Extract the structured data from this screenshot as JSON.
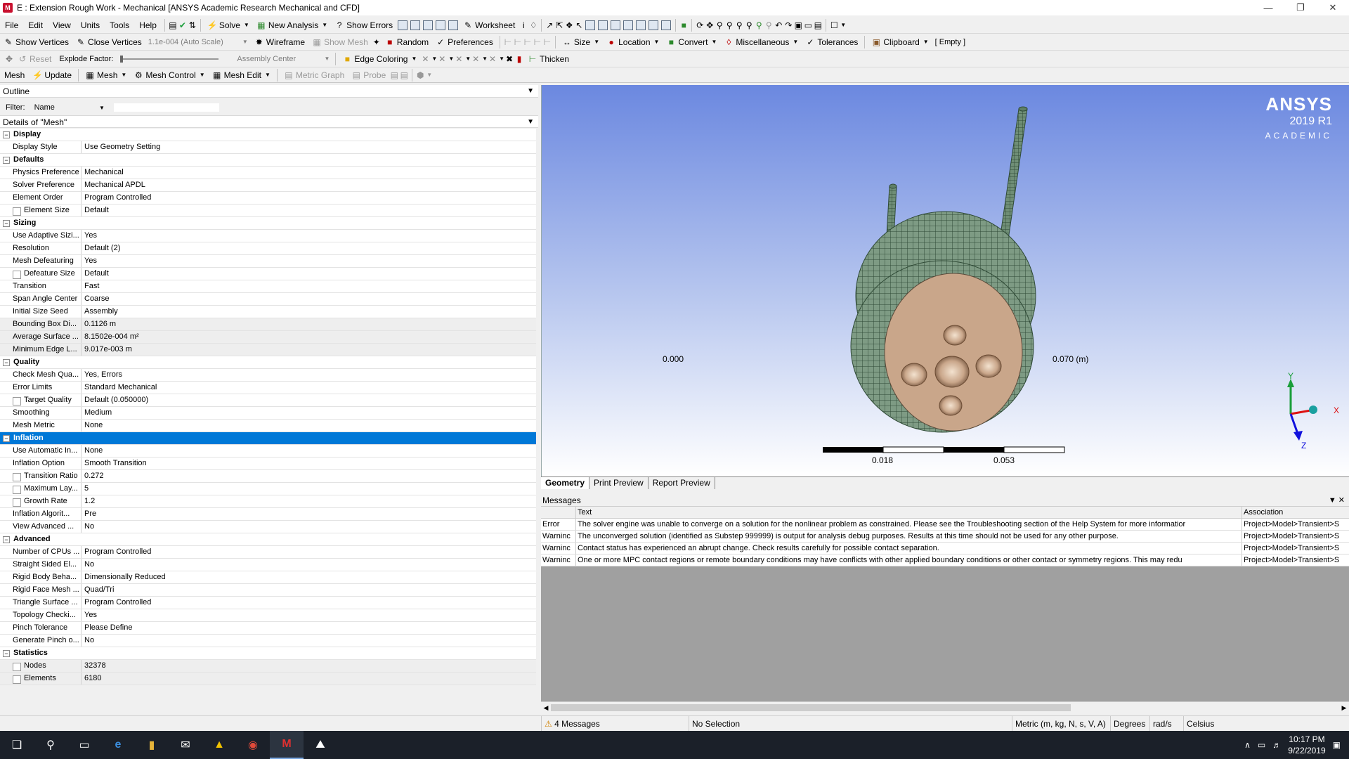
{
  "window": {
    "title": "E : Extension Rough Work - Mechanical [ANSYS Academic Research Mechanical and CFD]",
    "app_icon_letter": "M"
  },
  "menu": [
    "File",
    "Edit",
    "View",
    "Units",
    "Tools",
    "Help"
  ],
  "toolbar1": {
    "solve": "Solve",
    "new_analysis": "New Analysis",
    "show_errors": "Show Errors",
    "worksheet": "Worksheet"
  },
  "toolbar2": {
    "show_vertices": "Show Vertices",
    "close_vertices": "Close Vertices",
    "scale_combo": "1.1e-004 (Auto Scale)",
    "wireframe": "Wireframe",
    "show_mesh": "Show Mesh",
    "random": "Random",
    "preferences": "Preferences",
    "size": "Size",
    "location": "Location",
    "convert": "Convert",
    "miscellaneous": "Miscellaneous",
    "tolerances": "Tolerances",
    "clipboard": "Clipboard",
    "clipboard_value": "[ Empty ]"
  },
  "toolbar3": {
    "reset": "Reset",
    "explode_factor": "Explode Factor:",
    "assembly_center": "Assembly Center",
    "edge_coloring": "Edge Coloring",
    "thicken": "Thicken"
  },
  "toolbar4": {
    "mesh": "Mesh",
    "update": "Update",
    "mesh_dd": "Mesh",
    "mesh_control": "Mesh Control",
    "mesh_edit": "Mesh Edit",
    "metric_graph": "Metric Graph",
    "probe": "Probe"
  },
  "outline": {
    "title": "Outline",
    "filter_label": "Filter:",
    "filter_value": "Name"
  },
  "details": {
    "title": "Details of \"Mesh\"",
    "groups": [
      {
        "name": "Display",
        "rows": [
          {
            "k": "Display Style",
            "v": "Use Geometry Setting"
          }
        ]
      },
      {
        "name": "Defaults",
        "rows": [
          {
            "k": "Physics Preference",
            "v": "Mechanical"
          },
          {
            "k": "Solver Preference",
            "v": "Mechanical APDL"
          },
          {
            "k": "Element Order",
            "v": "Program Controlled"
          },
          {
            "k": "Element Size",
            "v": "Default",
            "cb": true
          }
        ]
      },
      {
        "name": "Sizing",
        "rows": [
          {
            "k": "Use Adaptive Sizi...",
            "v": "Yes"
          },
          {
            "k": "Resolution",
            "v": "Default (2)"
          },
          {
            "k": "Mesh Defeaturing",
            "v": "Yes"
          },
          {
            "k": "Defeature Size",
            "v": "Default",
            "cb": true
          },
          {
            "k": "Transition",
            "v": "Fast"
          },
          {
            "k": "Span Angle Center",
            "v": "Coarse"
          },
          {
            "k": "Initial Size Seed",
            "v": "Assembly"
          },
          {
            "k": "Bounding Box Di...",
            "v": "0.1126 m",
            "ro": true
          },
          {
            "k": "Average Surface ...",
            "v": "8.1502e-004 m²",
            "ro": true
          },
          {
            "k": "Minimum Edge L...",
            "v": "9.017e-003 m",
            "ro": true
          }
        ]
      },
      {
        "name": "Quality",
        "rows": [
          {
            "k": "Check Mesh Qua...",
            "v": "Yes, Errors"
          },
          {
            "k": "Error Limits",
            "v": "Standard Mechanical"
          },
          {
            "k": "Target Quality",
            "v": "Default (0.050000)",
            "cb": true
          },
          {
            "k": "Smoothing",
            "v": "Medium"
          },
          {
            "k": "Mesh Metric",
            "v": "None"
          }
        ]
      },
      {
        "name": "Inflation",
        "selected": true,
        "rows": [
          {
            "k": "Use Automatic In...",
            "v": "None"
          },
          {
            "k": "Inflation Option",
            "v": "Smooth Transition"
          },
          {
            "k": "Transition Ratio",
            "v": "0.272",
            "cb": true
          },
          {
            "k": "Maximum Lay...",
            "v": "5",
            "cb": true
          },
          {
            "k": "Growth Rate",
            "v": "1.2",
            "cb": true
          },
          {
            "k": "Inflation Algorit...",
            "v": "Pre"
          },
          {
            "k": "View Advanced ...",
            "v": "No"
          }
        ]
      },
      {
        "name": "Advanced",
        "rows": [
          {
            "k": "Number of CPUs ...",
            "v": "Program Controlled"
          },
          {
            "k": "Straight Sided El...",
            "v": "No"
          },
          {
            "k": "Rigid Body Beha...",
            "v": "Dimensionally Reduced"
          },
          {
            "k": "Rigid Face Mesh ...",
            "v": "Quad/Tri"
          },
          {
            "k": "Triangle Surface ...",
            "v": "Program Controlled"
          },
          {
            "k": "Topology Checki...",
            "v": "Yes"
          },
          {
            "k": "Pinch Tolerance",
            "v": "Please Define"
          },
          {
            "k": "Generate Pinch o...",
            "v": "No"
          }
        ]
      },
      {
        "name": "Statistics",
        "rows": [
          {
            "k": "Nodes",
            "v": "32378",
            "cb": true,
            "ro": true
          },
          {
            "k": "Elements",
            "v": "6180",
            "cb": true,
            "ro": true
          }
        ]
      }
    ]
  },
  "viewport": {
    "logo_line1": "ANSYS",
    "logo_line2": "2019 R1",
    "logo_line3": "ACADEMIC",
    "scale_labels": {
      "start": "0.000",
      "end": "0.070 (m)",
      "mid1": "0.018",
      "mid2": "0.053"
    },
    "triad": {
      "x": "X",
      "y": "Y",
      "z": "Z"
    }
  },
  "view_tabs": [
    "Geometry",
    "Print Preview",
    "Report Preview"
  ],
  "messages": {
    "title": "Messages",
    "columns": [
      "",
      "Text",
      "Association"
    ],
    "rows": [
      {
        "type": "Error",
        "text": "The solver engine was unable to converge on a solution for the nonlinear problem as constrained.  Please see the Troubleshooting section of the Help System for more informatior",
        "assoc": "Project>Model>Transient>S"
      },
      {
        "type": "Warninc",
        "text": "The unconverged solution (identified as Substep 999999) is output for analysis debug purposes. Results at this time should not be used for any other purpose.",
        "assoc": "Project>Model>Transient>S"
      },
      {
        "type": "Warninc",
        "text": "Contact status has experienced an abrupt change.  Check results carefully for possible contact separation.",
        "assoc": "Project>Model>Transient>S"
      },
      {
        "type": "Warninc",
        "text": "One or more MPC contact regions or remote boundary conditions may have conflicts with other applied boundary conditions or other contact or symmetry regions. This may redu",
        "assoc": "Project>Model>Transient>S"
      }
    ]
  },
  "status": {
    "messages": "4 Messages",
    "selection": "No Selection",
    "units": "Metric (m, kg, N, s, V, A)",
    "angle": "Degrees",
    "rate": "rad/s",
    "temp": "Celsius"
  },
  "taskbar": {
    "time": "10:17 PM",
    "date": "9/22/2019"
  },
  "colors": {
    "selection": "#0078d7",
    "viewport_top": "#6b88e0",
    "mesh_green": "#5f7f66",
    "face_tan": "#c9a68a"
  }
}
